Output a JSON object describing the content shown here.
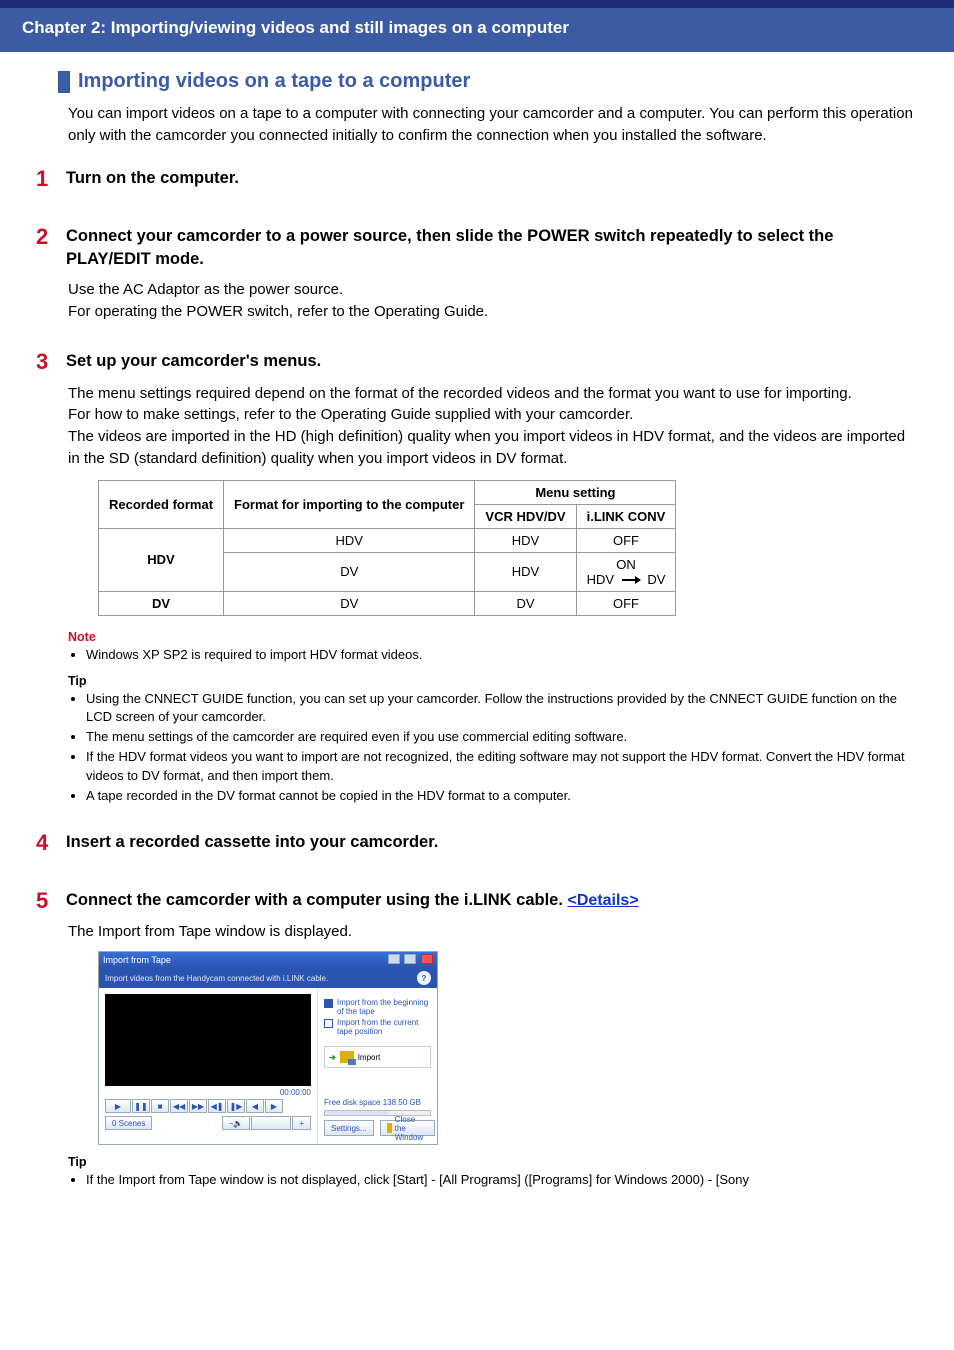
{
  "chapter": "Chapter 2: Importing/viewing videos and still images on a computer",
  "title": "Importing videos on a tape to a computer",
  "intro": "You can import videos on a tape to a computer with connecting your camcorder and a computer. You can perform this operation only with the camcorder you connected initially to confirm the connection when you installed the software.",
  "steps": {
    "s1": {
      "num": "1",
      "head": "Turn on the computer."
    },
    "s2": {
      "num": "2",
      "head": "Connect your camcorder to a power source, then slide the POWER switch repeatedly to select the PLAY/EDIT mode.",
      "body": "Use the AC Adaptor as the power source.\nFor operating the POWER switch, refer to the Operating Guide."
    },
    "s3": {
      "num": "3",
      "head": "Set up your camcorder's menus.",
      "body": "The menu settings required depend on the format of the recorded videos and the format you want to use for importing.\nFor how to make settings, refer to the Operating Guide supplied with your camcorder.\nThe videos are imported in the HD (high definition) quality when you import videos in HDV format, and the videos are imported in the SD (standard definition) quality when you import videos in DV format."
    },
    "s4": {
      "num": "4",
      "head": "Insert a recorded cassette into your camcorder."
    },
    "s5": {
      "num": "5",
      "head_a": "Connect the camcorder with a computer using the i.LINK cable. ",
      "details": "<Details>",
      "body": "The Import from Tape window is displayed."
    }
  },
  "table": {
    "head": {
      "rec": "Recorded format",
      "fmt": "Format for importing to the computer",
      "menu": "Menu setting",
      "vcr": "VCR HDV/DV",
      "ilink": "i.LINK CONV"
    },
    "rows": [
      {
        "rec": "HDV",
        "fmt": "HDV",
        "vcr": "HDV",
        "ilink": "OFF"
      },
      {
        "rec": "",
        "fmt": "DV",
        "vcr": "HDV",
        "ilink_on": "ON",
        "ilink_from": "HDV",
        "ilink_to": "DV"
      },
      {
        "rec": "DV",
        "fmt": "DV",
        "vcr": "DV",
        "ilink": "OFF"
      }
    ]
  },
  "note": {
    "label": "Note",
    "items": [
      "Windows XP SP2 is required to import HDV format videos."
    ]
  },
  "tip3": {
    "label": "Tip",
    "items": [
      "Using the CNNECT GUIDE function, you can set up your camcorder. Follow the instructions provided by the CNNECT GUIDE function on the LCD screen of your camcorder.",
      "The menu settings of the camcorder are required even if you use commercial editing software.",
      "If the HDV format videos you want to import are not recognized, the editing software may not support the HDV format. Convert the HDV format videos to DV format, and then import them.",
      "A tape recorded in the DV format cannot be copied in the HDV format to a computer."
    ]
  },
  "tip5": {
    "label": "Tip",
    "items": [
      "If the Import from Tape window is not displayed, click [Start] - [All Programs] ([Programs] for Windows 2000) - [Sony"
    ]
  },
  "mock": {
    "title": "Import from Tape",
    "subtitle": "Import videos from the Handycam connected with i.LINK cable.",
    "opt1": "Import from the beginning of the tape",
    "opt2": "Import from the current tape position",
    "import": "Import",
    "time": "00:00:00",
    "free": "Free disk space 138.50 GB",
    "settings": "Settings...",
    "close": "Close the Window",
    "scene": "0 Scenes"
  }
}
